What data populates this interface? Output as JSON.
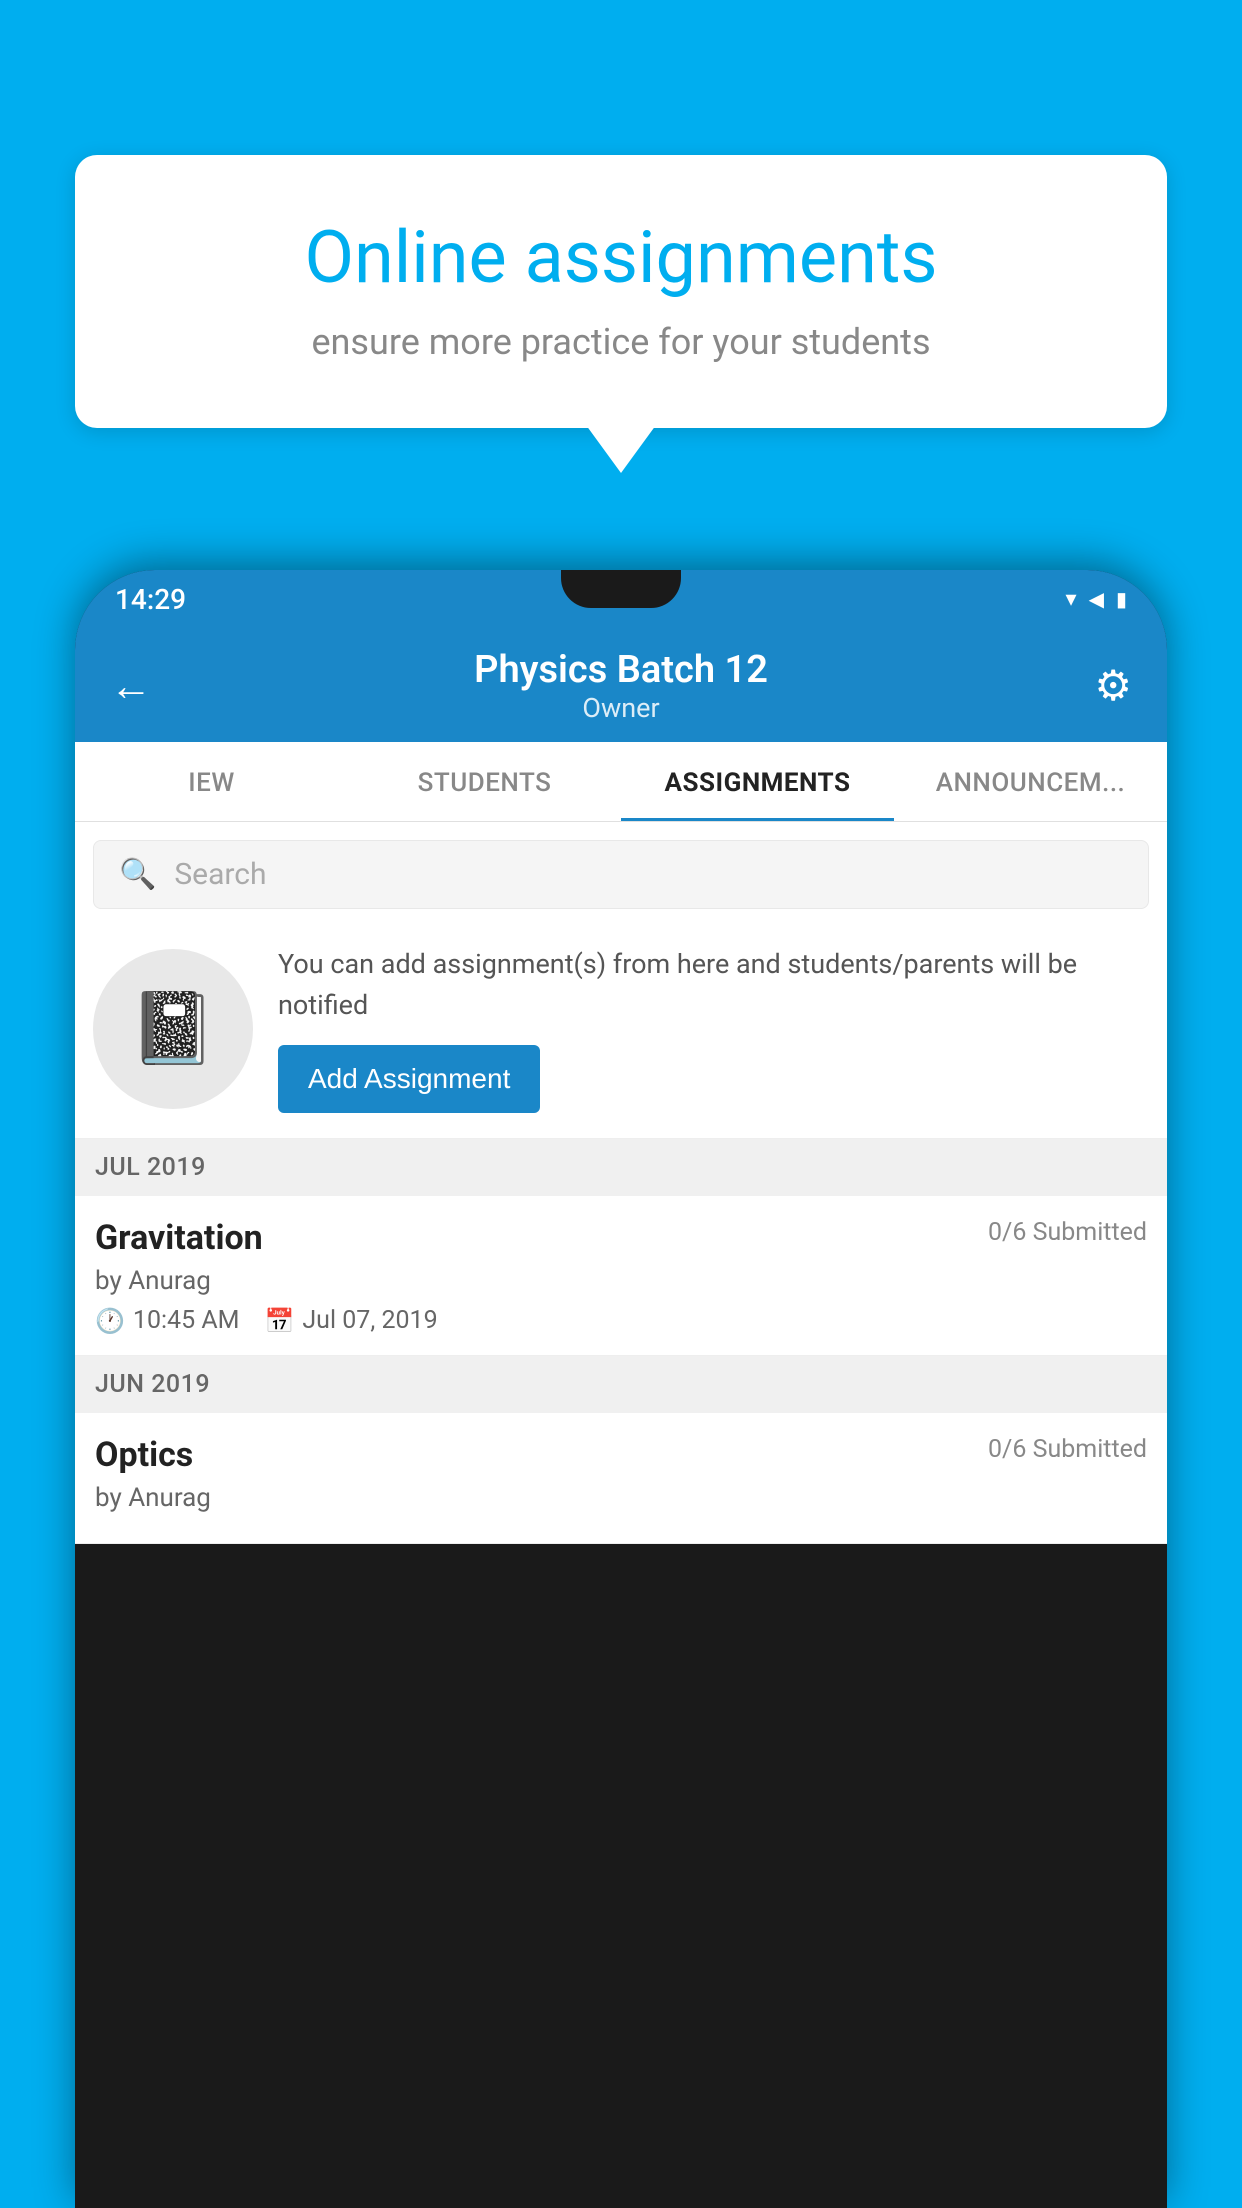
{
  "background_color": "#00AEEF",
  "speech_bubble": {
    "title": "Online assignments",
    "subtitle": "ensure more practice for your students"
  },
  "status_bar": {
    "time": "14:29",
    "icons": [
      "wifi",
      "signal",
      "battery"
    ]
  },
  "app_bar": {
    "title": "Physics Batch 12",
    "subtitle": "Owner",
    "back_label": "←",
    "settings_label": "⚙"
  },
  "tabs": [
    {
      "label": "IEW",
      "active": false
    },
    {
      "label": "STUDENTS",
      "active": false
    },
    {
      "label": "ASSIGNMENTS",
      "active": true
    },
    {
      "label": "ANNOUNCEM...",
      "active": false
    }
  ],
  "search": {
    "placeholder": "Search"
  },
  "promo": {
    "description": "You can add assignment(s) from here and students/parents will be notified",
    "add_button_label": "Add Assignment"
  },
  "sections": [
    {
      "header": "JUL 2019",
      "assignments": [
        {
          "name": "Gravitation",
          "submitted": "0/6 Submitted",
          "by": "by Anurag",
          "time": "10:45 AM",
          "date": "Jul 07, 2019"
        }
      ]
    },
    {
      "header": "JUN 2019",
      "assignments": [
        {
          "name": "Optics",
          "submitted": "0/6 Submitted",
          "by": "by Anurag",
          "time": "",
          "date": ""
        }
      ]
    }
  ]
}
